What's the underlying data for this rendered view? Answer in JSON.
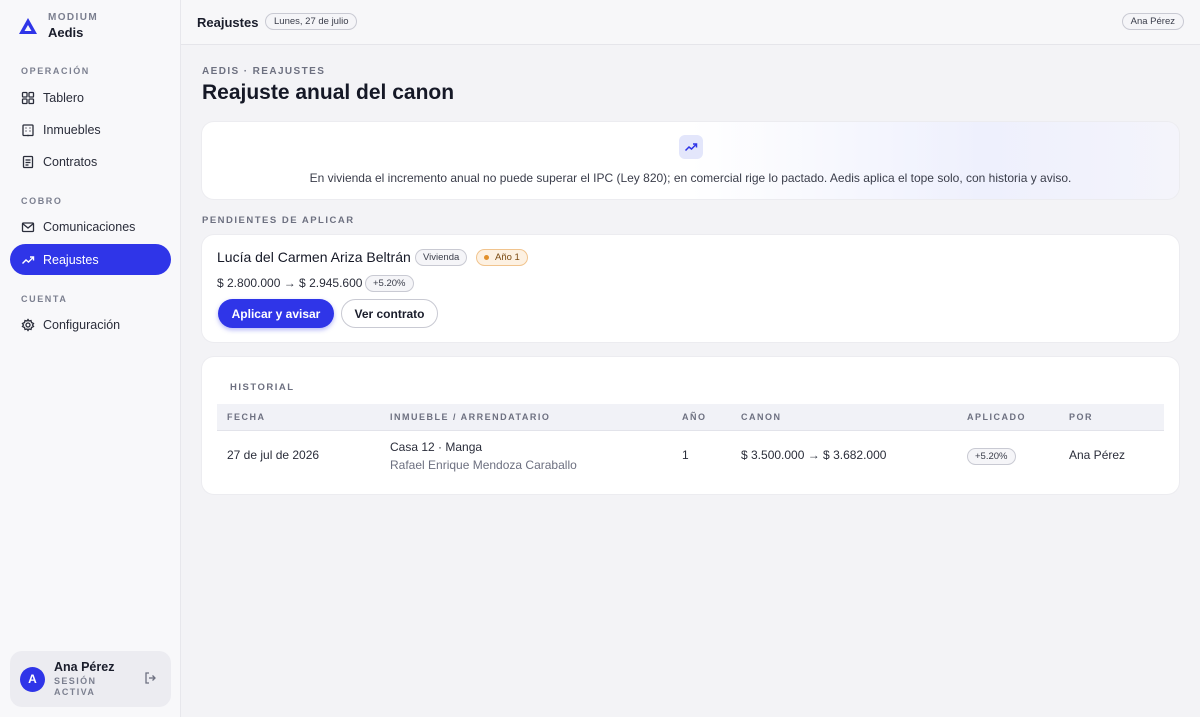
{
  "sidebar": {
    "brand_small": "MODIUM",
    "brand_name": "Aedis",
    "sections": {
      "operacion": "OPERACIÓN",
      "cobro": "COBRO",
      "cuenta": "CUENTA"
    },
    "items": [
      {
        "label": "Tablero",
        "icon": "grid-icon"
      },
      {
        "label": "Inmuebles",
        "icon": "building-icon"
      },
      {
        "label": "Contratos",
        "icon": "document-icon"
      },
      {
        "label": "Comunicaciones",
        "icon": "mail-icon"
      },
      {
        "label": "Reajustes",
        "icon": "trend-up-icon",
        "active": true
      },
      {
        "label": "Configuración",
        "icon": "gear-icon"
      }
    ],
    "user": {
      "initial": "A",
      "name": "Ana Pérez",
      "status": "SESIÓN ACTIVA"
    }
  },
  "topbar": {
    "title": "Reajustes",
    "date": "Lunes, 27 de julio",
    "user": "Ana Pérez"
  },
  "main": {
    "breadcrumb": "AEDIS · REAJUSTES",
    "title": "Reajuste anual del canon",
    "notice": "En vivienda el incremento anual no puede superar el IPC (Ley 820); en comercial rige lo pactado. Aedis aplica el tope solo, con historia y aviso.",
    "pending_label": "PENDIENTES DE APLICAR",
    "pending": {
      "tenant": "Lucía del Carmen Ariza Beltrán",
      "type_tag": "Vivienda",
      "year_tag": "Año 1",
      "amount": "$ 2.800.000 → $ 2.945.600",
      "pct": "+5.20%",
      "apply_button": "Aplicar y avisar",
      "contract_button": "Ver contrato"
    },
    "history": {
      "label": "HISTORIAL",
      "columns": [
        "FECHA",
        "INMUEBLE / ARRENDATARIO",
        "AÑO",
        "CANON",
        "APLICADO",
        "POR"
      ],
      "rows": [
        {
          "fecha": "27 de jul de 2026",
          "inmueble": "Casa 12 · Manga",
          "arrendatario": "Rafael Enrique Mendoza Caraballo",
          "anio": "1",
          "canon": "$ 3.500.000 → $ 3.682.000",
          "aplicado": "+5.20%",
          "por": "Ana Pérez"
        }
      ]
    }
  },
  "colors": {
    "accent": "#2f35e8",
    "amber": "#e2902b"
  }
}
